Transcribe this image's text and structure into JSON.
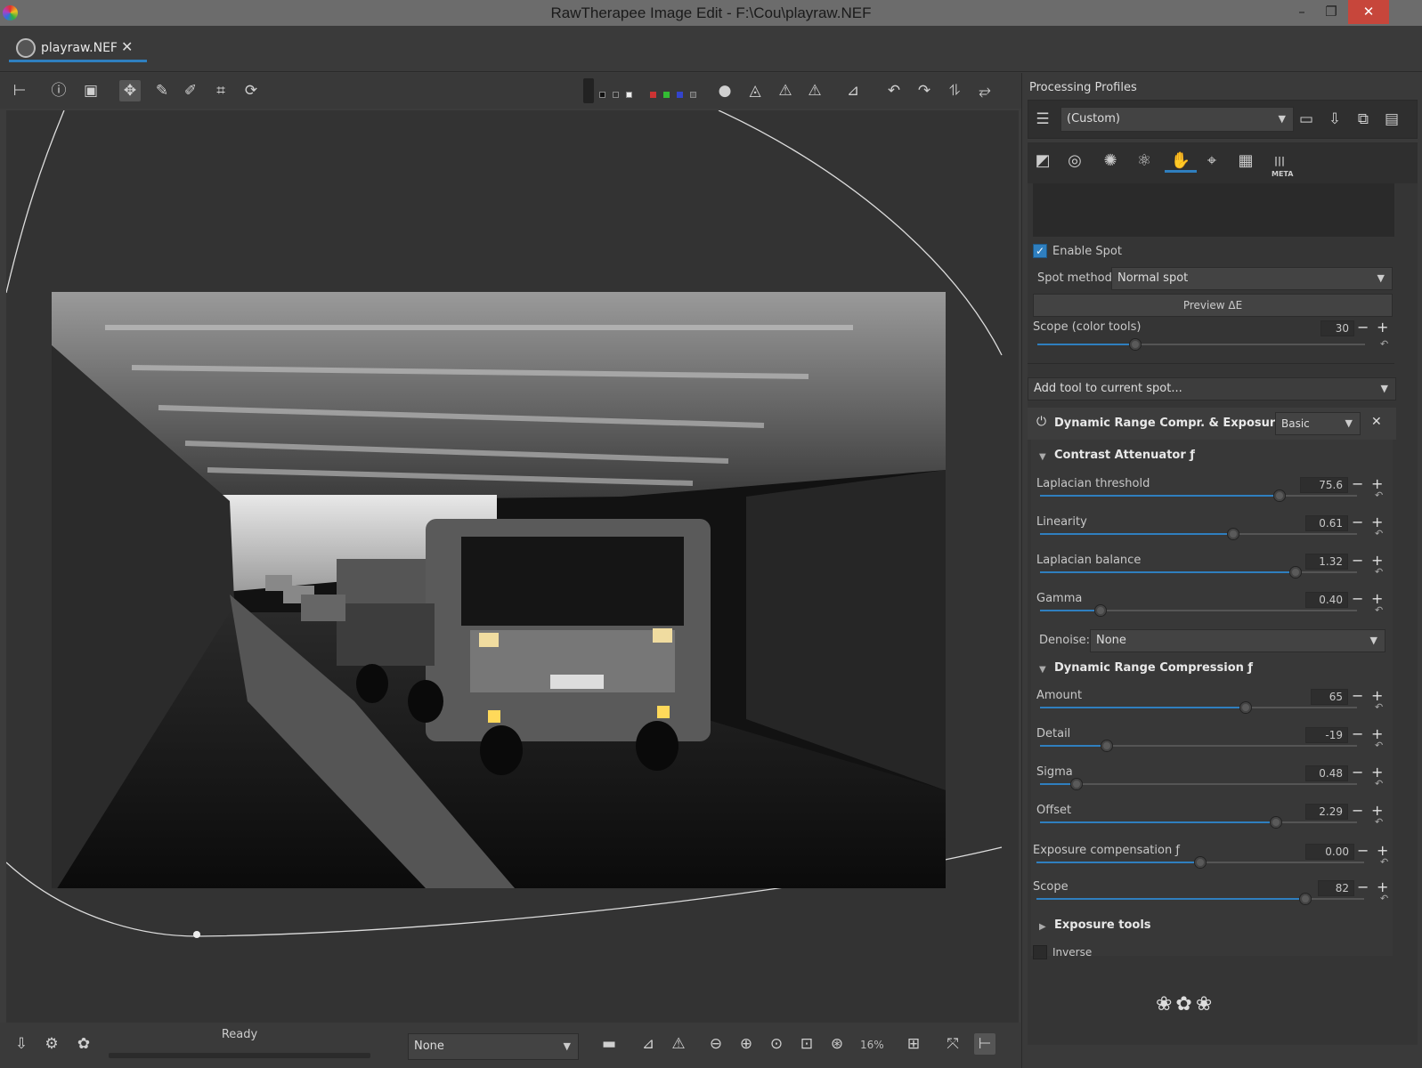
{
  "window": {
    "title": "RawTherapee Image Edit - F:\\Cou\\playraw.NEF",
    "min_label": "–",
    "max_label": "❐",
    "close_label": "✕"
  },
  "tab": {
    "label": "playraw.NEF",
    "close": "✕"
  },
  "status": {
    "text": "Ready",
    "zoom": "16%",
    "dropdown": "None"
  },
  "profiles": {
    "header": "Processing Profiles",
    "selected": "(Custom)"
  },
  "spot": {
    "enable_label": "Enable Spot",
    "enabled": true,
    "method_label": "Spot method:",
    "method_value": "Normal spot",
    "preview_button": "Preview ΔE",
    "scope_label": "Scope (color tools)",
    "scope_value": "30",
    "scope_fraction": 0.3,
    "add_tool_label": "Add tool to current spot..."
  },
  "module": {
    "title": "Dynamic Range Compr. & Exposure",
    "complexity": "Basic",
    "contrast_section": "Contrast Attenuator ƒ",
    "drc_section": "Dynamic Range Compression ƒ",
    "exposure_tools_section": "Exposure tools",
    "denoise_label": "Denoise:",
    "denoise_value": "None",
    "inverse_label": "Inverse",
    "inverse_checked": false
  },
  "sliders": [
    {
      "label": "Laplacian threshold",
      "value": "75.6",
      "fraction": 0.756
    },
    {
      "label": "Linearity",
      "value": "0.61",
      "fraction": 0.61
    },
    {
      "label": "Laplacian balance",
      "value": "1.32",
      "fraction": 0.805
    },
    {
      "label": "Gamma",
      "value": "0.40",
      "fraction": 0.19
    },
    {
      "label": "Amount",
      "value": "65",
      "fraction": 0.65
    },
    {
      "label": "Detail",
      "value": "-19",
      "fraction": 0.21
    },
    {
      "label": "Sigma",
      "value": "0.48",
      "fraction": 0.115
    },
    {
      "label": "Offset",
      "value": "2.29",
      "fraction": 0.745
    },
    {
      "label": "Exposure compensation ƒ",
      "value": "0.00",
      "fraction": 0.5
    },
    {
      "label": "Scope",
      "value": "82",
      "fraction": 0.82
    }
  ],
  "colors": {
    "accent": "#2f7fbf",
    "close": "#c7463b",
    "panel": "#353535"
  }
}
